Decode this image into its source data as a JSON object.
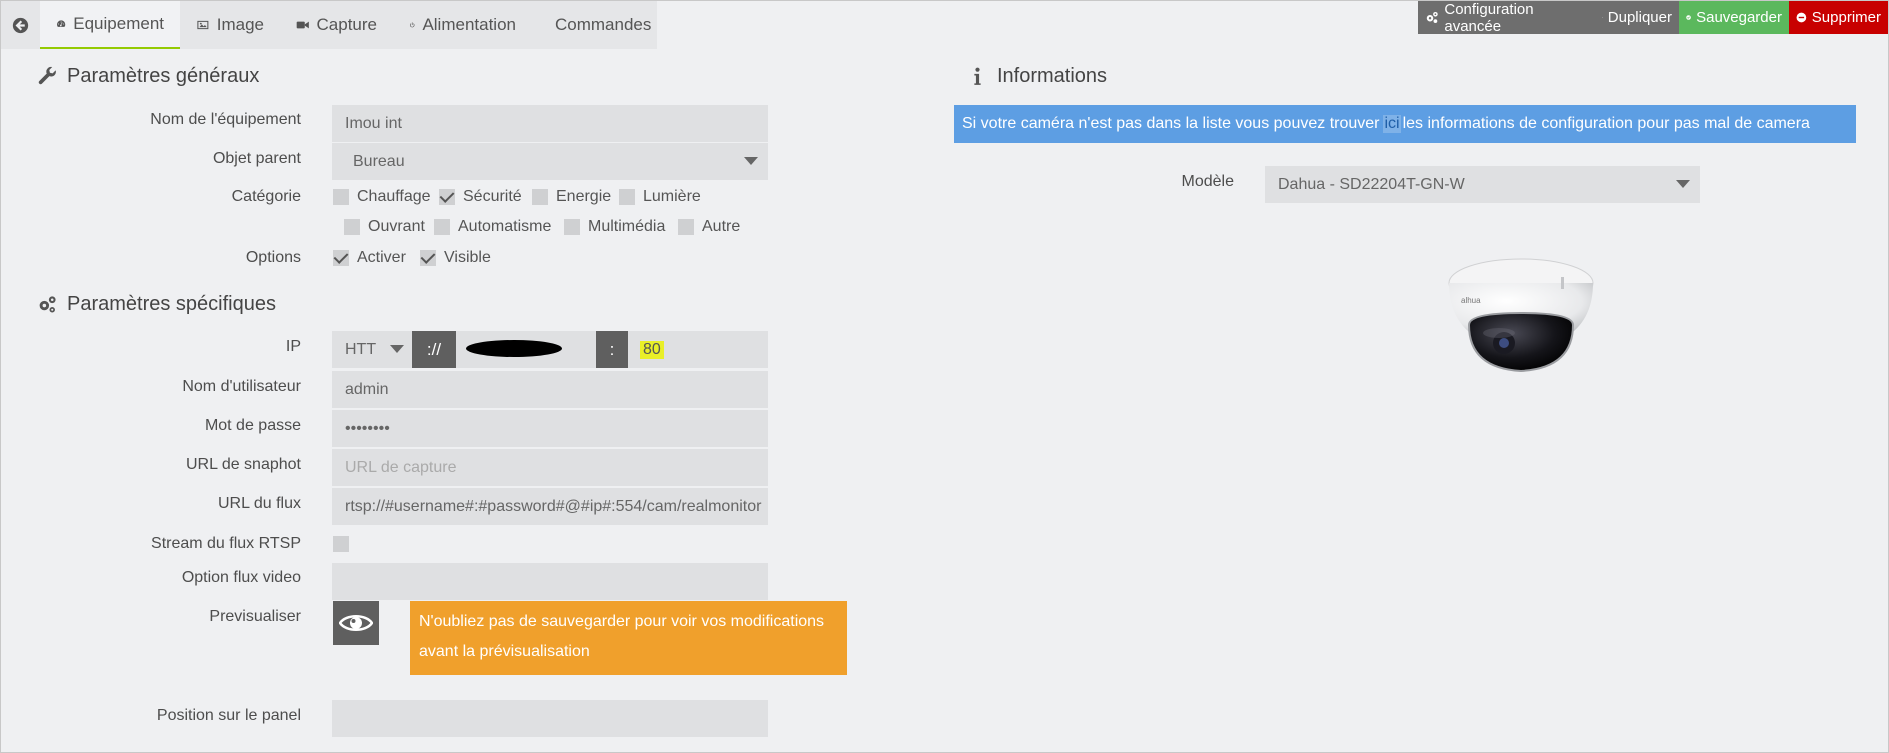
{
  "tabs": [
    {
      "label": "Equipement",
      "icon": "tachometer-icon"
    },
    {
      "label": "Image",
      "icon": "picture-icon"
    },
    {
      "label": "Capture",
      "icon": "video-camera-icon"
    },
    {
      "label": "Alimentation",
      "icon": "power-icon"
    },
    {
      "label": "Commandes",
      "icon": "list-icon"
    }
  ],
  "actions": {
    "config_avancee": "Configuration avancée",
    "dupliquer": "Dupliquer",
    "sauvegarder": "Sauvegarder",
    "supprimer": "Supprimer"
  },
  "colors": {
    "accent_green": "#94ca02",
    "save": "#5bb85d",
    "delete": "#c80000",
    "info": "#5d9ee3",
    "warning": "#f0a02c"
  },
  "general": {
    "title": "Paramètres généraux",
    "nom_label": "Nom de l'équipement",
    "nom_value": "Imou int",
    "objet_label": "Objet parent",
    "objet_value": "Bureau",
    "categorie_label": "Catégorie",
    "categories": [
      {
        "label": "Chauffage",
        "checked": false
      },
      {
        "label": "Sécurité",
        "checked": true
      },
      {
        "label": "Energie",
        "checked": false
      },
      {
        "label": "Lumière",
        "checked": false
      },
      {
        "label": "Ouvrant",
        "checked": false
      },
      {
        "label": "Automatisme",
        "checked": false
      },
      {
        "label": "Multimédia",
        "checked": false
      },
      {
        "label": "Autre",
        "checked": false
      }
    ],
    "options_label": "Options",
    "options": [
      {
        "label": "Activer",
        "checked": true
      },
      {
        "label": "Visible",
        "checked": true
      }
    ]
  },
  "specific": {
    "title": "Paramètres spécifiques",
    "ip_label": "IP",
    "protocol_value": "HTTP",
    "separator": "://",
    "colon": ":",
    "port_value": "80",
    "user_label": "Nom d'utilisateur",
    "user_value": "admin",
    "password_label": "Mot de passe",
    "password_value": "••••••••",
    "snapshot_label": "URL de snaphot",
    "snapshot_placeholder": "URL de capture",
    "flux_label": "URL du flux",
    "flux_value": "rtsp://#username#:#password#@#ip#:554/cam/realmonitor",
    "stream_label": "Stream du flux RTSP",
    "option_video_label": "Option flux video",
    "preview_label": "Previsualiser",
    "warning": "N'oubliez pas de sauvegarder pour voir vos modifications avant la prévisualisation",
    "panel_label": "Position sur le panel"
  },
  "info": {
    "title": "Informations",
    "text_before": "Si votre caméra n'est pas dans la liste vous pouvez trouver",
    "link": "ici",
    "text_after": "les informations de configuration pour pas mal de camera",
    "model_label": "Modèle",
    "model_value": "Dahua - SD22204T-GN-W",
    "camera_brand": "alhua"
  }
}
